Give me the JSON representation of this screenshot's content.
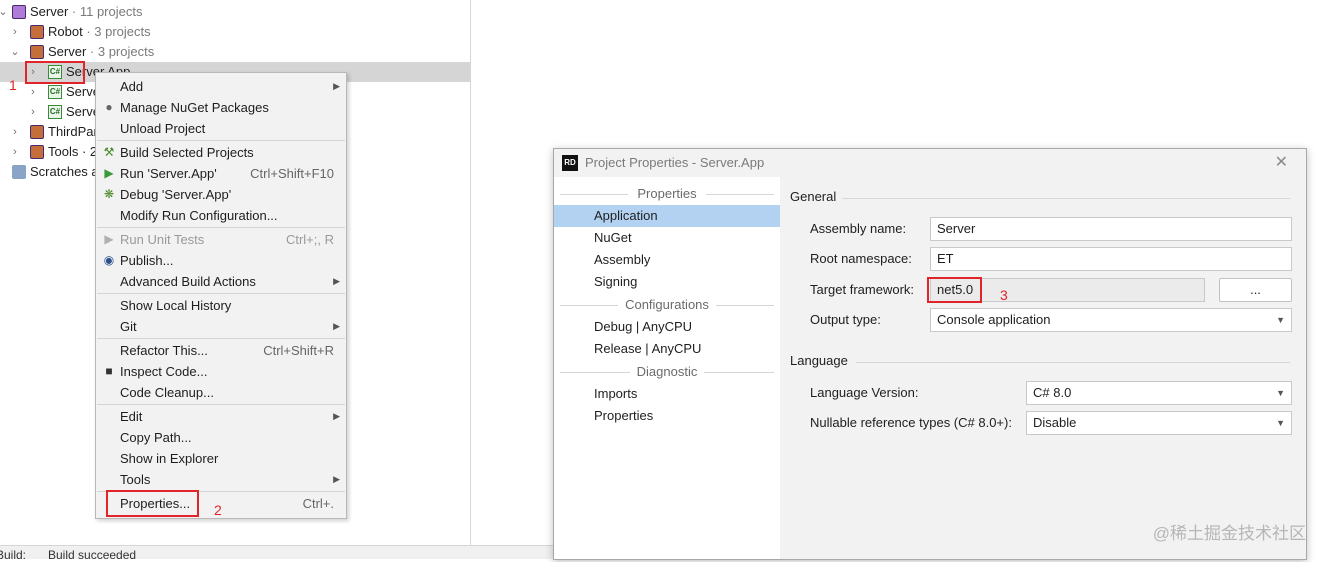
{
  "tree": {
    "root": {
      "name": "Server",
      "meta": " · 11 projects"
    },
    "items": [
      {
        "name": "Robot",
        "meta": " · 3 projects"
      },
      {
        "name": "Server",
        "meta": " · 3 projects"
      },
      {
        "name": "Server.App",
        "meta": ""
      },
      {
        "name": "Serve",
        "meta": ""
      },
      {
        "name": "Serve",
        "meta": ""
      },
      {
        "name": "ThirdPar",
        "meta": ""
      },
      {
        "name": "Tools · 2",
        "meta": ""
      },
      {
        "name": "Scratches a",
        "meta": ""
      }
    ]
  },
  "context_menu": {
    "items": [
      {
        "label": "Add",
        "shortcut": "",
        "submenu": true,
        "icon": ""
      },
      {
        "label": "Manage NuGet Packages",
        "shortcut": "",
        "submenu": false,
        "icon": "nuget-icon"
      },
      {
        "label": "Unload Project",
        "shortcut": "",
        "submenu": false,
        "icon": ""
      },
      {
        "label": "Build Selected Projects",
        "shortcut": "",
        "submenu": false,
        "icon": "hammer-icon"
      },
      {
        "label": "Run 'Server.App'",
        "shortcut": "Ctrl+Shift+F10",
        "submenu": false,
        "icon": "run-icon"
      },
      {
        "label": "Debug 'Server.App'",
        "shortcut": "",
        "submenu": false,
        "icon": "debug-icon"
      },
      {
        "label": "Modify Run Configuration...",
        "shortcut": "",
        "submenu": false,
        "icon": ""
      },
      {
        "label": "Run Unit Tests",
        "shortcut": "Ctrl+;, R",
        "submenu": false,
        "icon": "run-tests-icon",
        "disabled": true
      },
      {
        "label": "Publish...",
        "shortcut": "",
        "submenu": false,
        "icon": "publish-icon"
      },
      {
        "label": "Advanced Build Actions",
        "shortcut": "",
        "submenu": true,
        "icon": ""
      },
      {
        "label": "Show Local History",
        "shortcut": "",
        "submenu": false,
        "icon": ""
      },
      {
        "label": "Git",
        "shortcut": "",
        "submenu": true,
        "icon": ""
      },
      {
        "label": "Refactor This...",
        "shortcut": "Ctrl+Shift+R",
        "submenu": false,
        "icon": ""
      },
      {
        "label": "Inspect Code...",
        "shortcut": "",
        "submenu": false,
        "icon": "inspect-icon"
      },
      {
        "label": "Code Cleanup...",
        "shortcut": "",
        "submenu": false,
        "icon": ""
      },
      {
        "label": "Edit",
        "shortcut": "",
        "submenu": true,
        "icon": ""
      },
      {
        "label": "Copy Path...",
        "shortcut": "",
        "submenu": false,
        "icon": ""
      },
      {
        "label": "Show in Explorer",
        "shortcut": "",
        "submenu": false,
        "icon": ""
      },
      {
        "label": "Tools",
        "shortcut": "",
        "submenu": true,
        "icon": ""
      },
      {
        "label": "Properties...",
        "shortcut": "Ctrl+.",
        "submenu": false,
        "icon": ""
      }
    ]
  },
  "markers": [
    "1",
    "2",
    "3"
  ],
  "dialog": {
    "logo": "RD",
    "title": "Project Properties - Server.App",
    "close_icon": "close-icon",
    "sidebar": {
      "groups": [
        "Properties",
        "Configurations",
        "Diagnostic"
      ],
      "properties_items": [
        "Application",
        "NuGet",
        "Assembly",
        "Signing"
      ],
      "configuration_items": [
        "Debug | AnyCPU",
        "Release | AnyCPU"
      ],
      "diagnostic_items": [
        "Imports",
        "Properties"
      ],
      "selected": "Application"
    },
    "general": {
      "header": "General",
      "assembly_name_label": "Assembly name:",
      "assembly_name_value": "Server",
      "root_namespace_label": "Root namespace:",
      "root_namespace_value": "ET",
      "target_framework_label": "Target framework:",
      "target_framework_value": "net5.0",
      "browse_button": "...",
      "output_type_label": "Output type:",
      "output_type_value": "Console application"
    },
    "language": {
      "header": "Language",
      "language_version_label": "Language Version:",
      "language_version_value": "C# 8.0",
      "nullable_label": "Nullable reference types (C# 8.0+):",
      "nullable_value": "Disable"
    }
  },
  "status_bar": {
    "left": "Build:",
    "message": "Build succeeded"
  },
  "watermark": "@稀土掘金技术社区"
}
